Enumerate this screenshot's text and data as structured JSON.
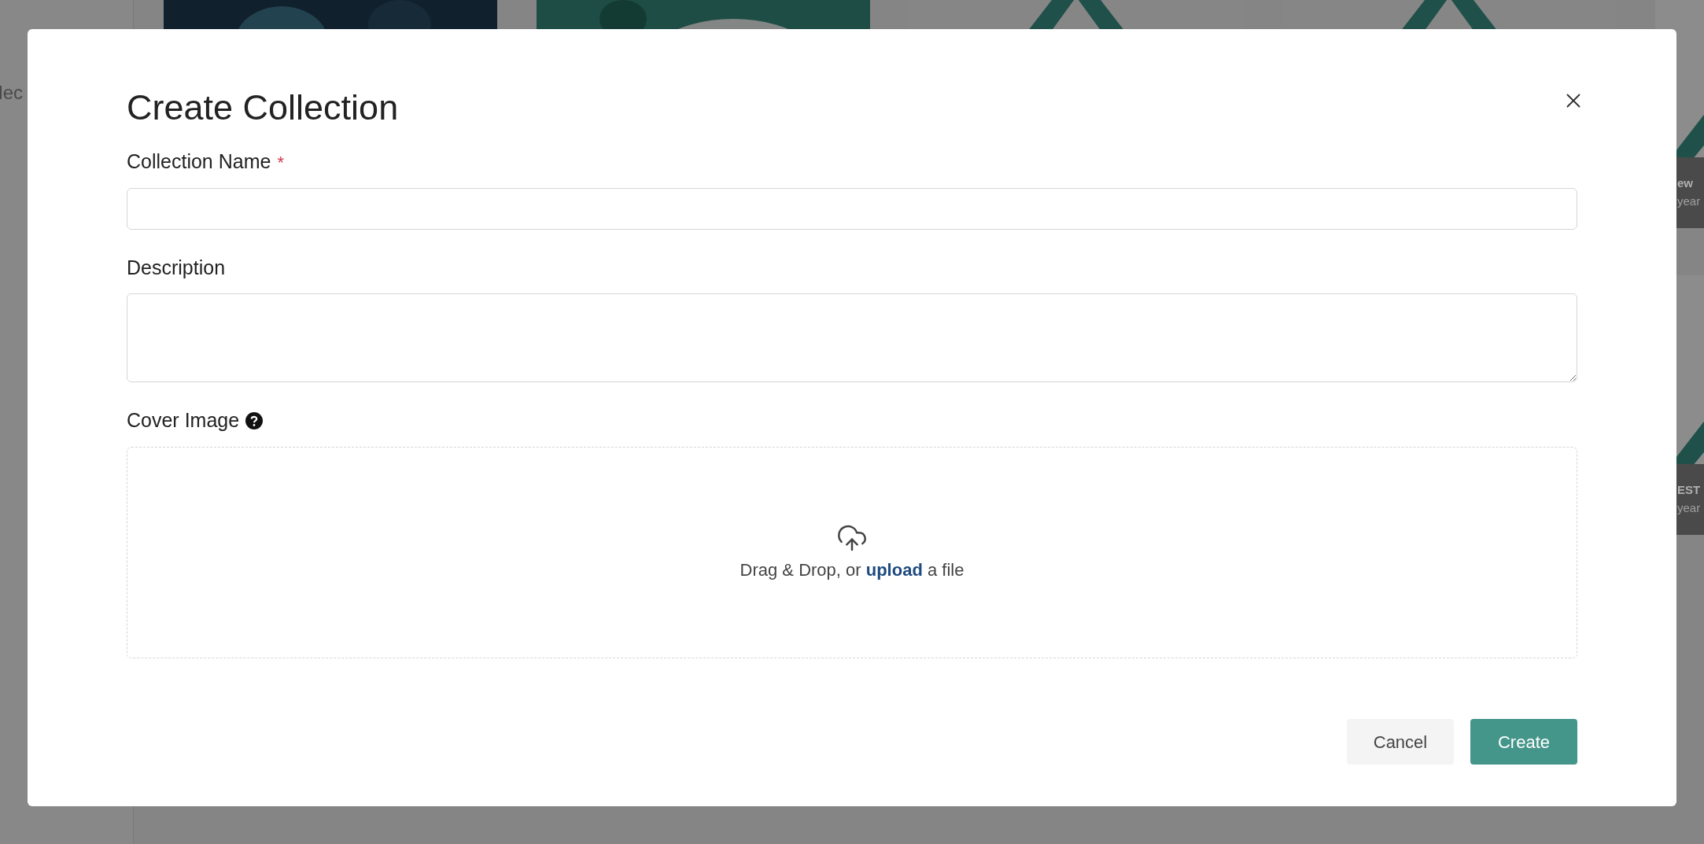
{
  "background": {
    "sidebar_text": "lec",
    "cards": [
      {
        "title": "ew",
        "subtitle": "year"
      },
      {
        "title": "EST",
        "subtitle": "year"
      }
    ]
  },
  "dialog": {
    "title": "Create Collection",
    "fields": [
      {
        "kind": "input",
        "label": "Collection Name",
        "required": true,
        "required_mark": "*"
      },
      {
        "kind": "textarea",
        "label": "Description",
        "required": false
      },
      {
        "kind": "dropzone",
        "label": "Cover Image",
        "help": true,
        "text_before": "Drag & Drop, or ",
        "link": "upload",
        "text_after": " a file"
      }
    ],
    "buttons": [
      {
        "label": "Cancel",
        "kind": "secondary"
      },
      {
        "label": "Create",
        "kind": "primary"
      }
    ]
  }
}
